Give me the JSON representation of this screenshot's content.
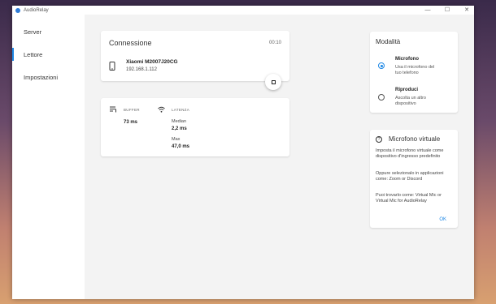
{
  "titlebar": {
    "app_title": "AudioRelay",
    "minimize": "—",
    "maximize": "☐",
    "close": "✕"
  },
  "sidebar": {
    "items": [
      {
        "label": "Server",
        "active": false
      },
      {
        "label": "Lettore",
        "active": true
      },
      {
        "label": "Impostazioni",
        "active": false
      }
    ]
  },
  "connection": {
    "title": "Connessione",
    "elapsed": "00:10",
    "device_name": "Xiaomi M2007J20CG",
    "device_ip": "192.168.1.112",
    "stop_icon": "stop-icon"
  },
  "stats": {
    "buffer_label": "BUFFER",
    "buffer_value": "73 ms",
    "latency_label": "LATENZA",
    "median_label": "Median",
    "median_value": "2,2 ms",
    "max_label": "Max",
    "max_value": "47,0 ms"
  },
  "mode": {
    "title": "Modalità",
    "options": [
      {
        "title": "Microfono",
        "desc": "Usa il microfono del tuo telefono",
        "checked": true
      },
      {
        "title": "Riproduci",
        "desc": "Ascolta un altro dispositivo",
        "checked": false
      }
    ]
  },
  "virtual_mic": {
    "title": "Microfono virtuale",
    "paragraph1": "Imposta il microfono virtuale come dispositivo d'ingresso predefinito",
    "paragraph2": "Oppure selezionalo in applicazioni come: Zoom or Discord",
    "paragraph3": "Puoi trovarlo come: Virtual Mic or Virtual Mic for AudioRelay",
    "ok_label": "OK"
  },
  "colors": {
    "accent": "#1e88e5",
    "window_bg": "#f3f3f3",
    "card_bg": "#ffffff"
  }
}
